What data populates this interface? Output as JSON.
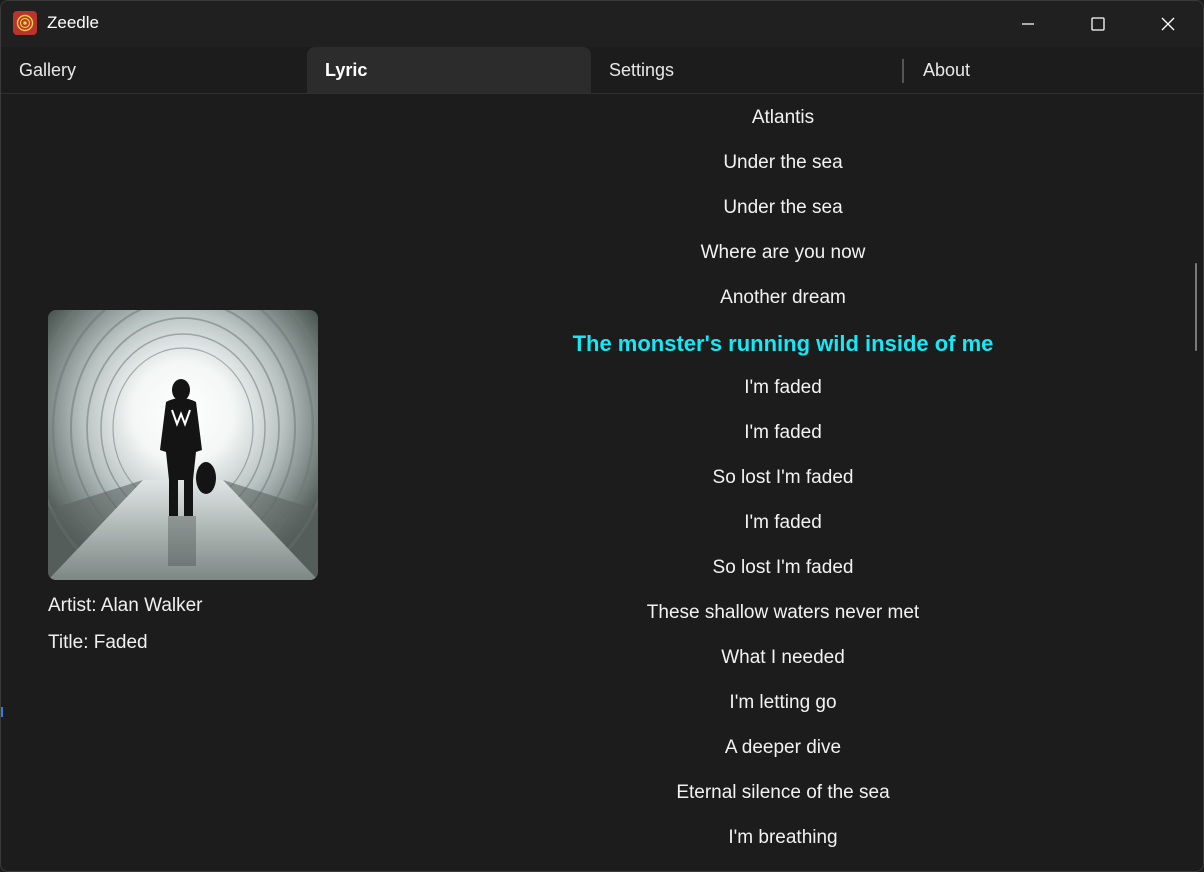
{
  "app": {
    "title": "Zeedle"
  },
  "tabs": [
    {
      "label": "Gallery"
    },
    {
      "label": "Lyric",
      "active": true
    },
    {
      "label": "Settings"
    },
    {
      "label": "About"
    }
  ],
  "song": {
    "artist": "Artist: Alan Walker",
    "title": "Title: Faded"
  },
  "lyrics": [
    "Atlantis",
    "Under the sea",
    "Under the sea",
    "Where are you now",
    "Another dream",
    "The monster's running wild inside of me",
    "I'm faded",
    "I'm faded",
    "So lost I'm faded",
    "I'm faded",
    "So lost I'm faded",
    "These shallow waters never met",
    "What I needed",
    "I'm letting go",
    "A deeper dive",
    "Eternal silence of the sea",
    "I'm breathing"
  ],
  "current_line_index": 5,
  "colors": {
    "highlight": "#14e9f5",
    "background": "#1c1c1c",
    "app_icon": "#b8342f"
  },
  "icons": [
    "app-logo-icon",
    "minimize-icon",
    "maximize-icon",
    "close-icon"
  ]
}
